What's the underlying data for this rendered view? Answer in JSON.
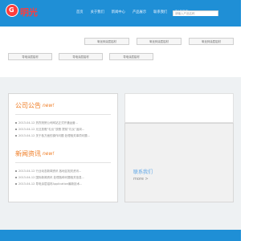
{
  "brand": {
    "logo_glyph": "G",
    "name": "明光"
  },
  "nav": [
    "首页",
    "关于我们",
    "新闻中心",
    "产品展示",
    "联系我们",
    "在线留言"
  ],
  "search": {
    "placeholder": "请输入产品名称"
  },
  "hero_tags": [
    "氧化锌涂层铝材",
    "氧化锌涂层铝材",
    "氧化锌涂层铝材",
    "导电涂层铝材",
    "导电涂层铝材",
    "导电涂层铝材"
  ],
  "company_news": {
    "title": "公司公告",
    "badge": "new!",
    "items": [
      "2013-04-12 热烈祝贺公司网站正式开通运营...",
      "2013-04-12 元旦放假“礼仪”放假 提前“礼仪”返岗...",
      "2013-04-12 关于各方面的操作问题 处理相关事项问题..."
    ]
  },
  "industry_news": {
    "title": "新闻资讯",
    "badge": "new!",
    "items": [
      "2013-04-12 行业动态新闻资讯 各地区相关资讯...",
      "2013-04-12 国际新闻资讯 处理各种问题相关信息...",
      "2013-04-12 导电涂层铝材Application最新技术..."
    ]
  },
  "contact": {
    "label": "联系我们",
    "more": "more >"
  },
  "colors": {
    "primary": "#1f8fd6",
    "accent": "#ef7b22",
    "link": "#5aa4e6"
  }
}
